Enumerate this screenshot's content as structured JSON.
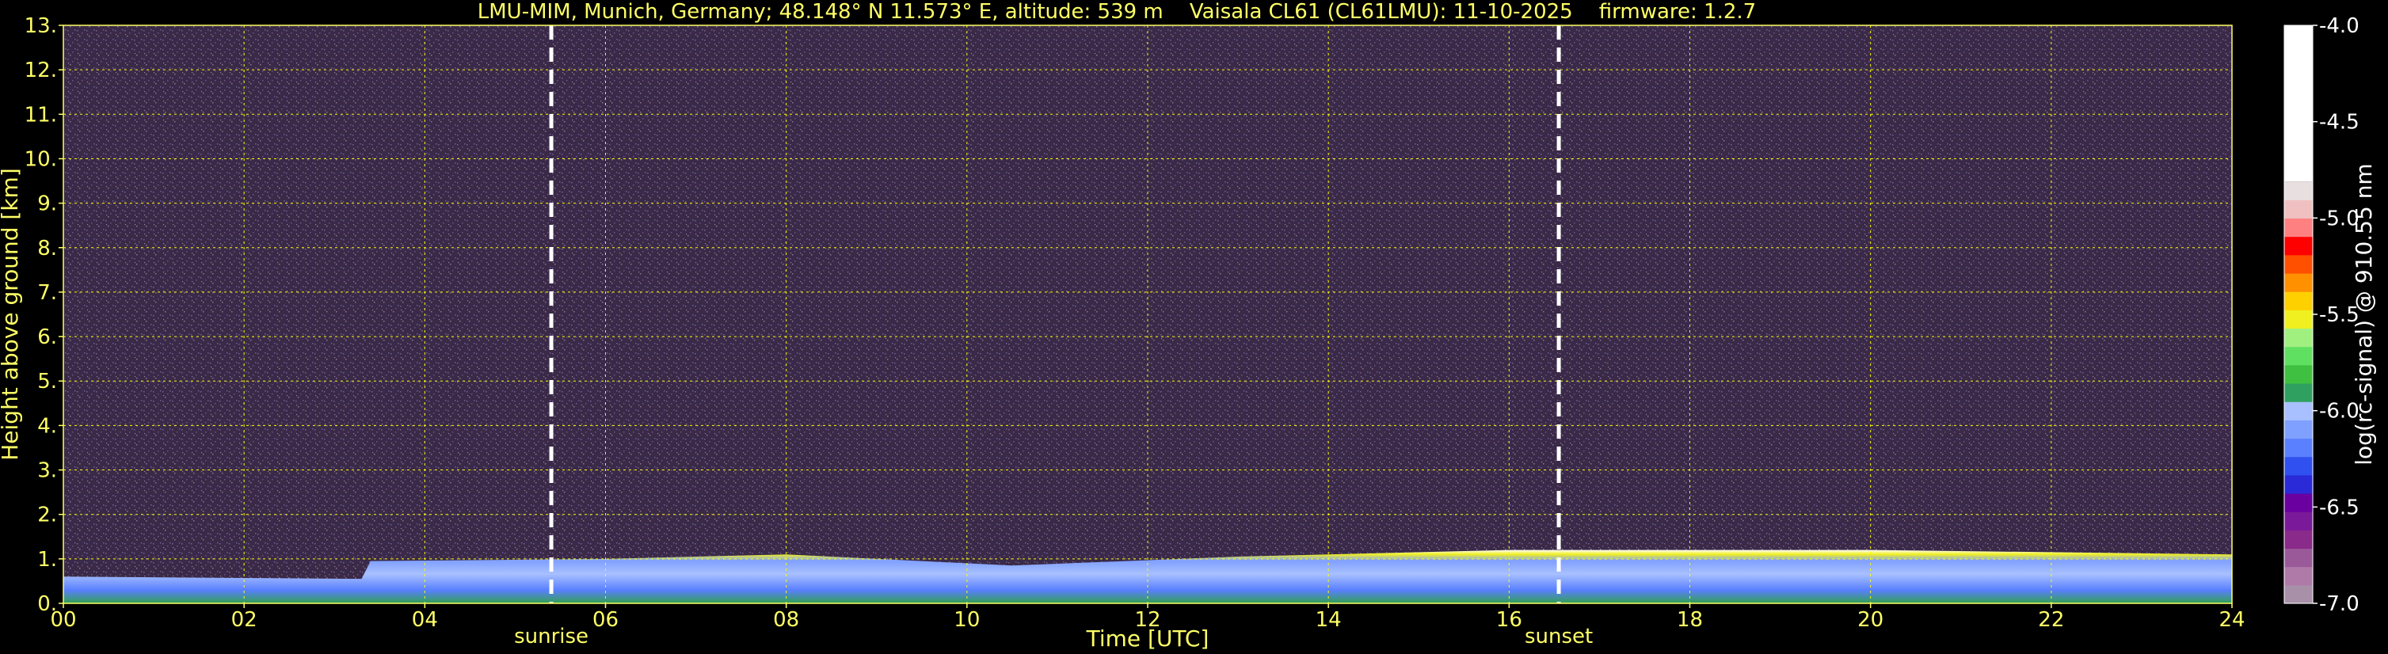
{
  "title": {
    "site": "LMU-MIM, Munich, Germany; 48.148° N 11.573° E, altitude: 539 m",
    "instrument": "Vaisala CL61 (CL61LMU): 11-10-2025",
    "firmware": "firmware: 1.2.7"
  },
  "chart_data": {
    "type": "heatmap",
    "xlabel": "Time [UTC]",
    "ylabel": "Height above ground [km]",
    "xlim": [
      0,
      24
    ],
    "ylim": [
      0,
      13
    ],
    "x_ticks": [
      "00",
      "02",
      "04",
      "06",
      "08",
      "10",
      "12",
      "14",
      "16",
      "18",
      "20",
      "22",
      "24"
    ],
    "y_ticks": [
      "0.",
      "1.",
      "2.",
      "3.",
      "4.",
      "5.",
      "6.",
      "7.",
      "8.",
      "9.",
      "10.",
      "11.",
      "12.",
      "13."
    ],
    "grid": true,
    "grid_color": "#ffff00",
    "annotations": [
      {
        "text": "sunrise",
        "x": 5.4
      },
      {
        "text": "sunset",
        "x": 16.55
      }
    ],
    "boundary_layer_top_km": [
      {
        "t": 0.0,
        "h": 0.6
      },
      {
        "t": 3.3,
        "h": 0.55
      },
      {
        "t": 3.4,
        "h": 0.95
      },
      {
        "t": 6.0,
        "h": 1.0
      },
      {
        "t": 8.0,
        "h": 1.1
      },
      {
        "t": 10.5,
        "h": 0.85
      },
      {
        "t": 13.0,
        "h": 1.05
      },
      {
        "t": 16.0,
        "h": 1.2
      },
      {
        "t": 20.0,
        "h": 1.2
      },
      {
        "t": 24.0,
        "h": 1.1
      }
    ],
    "colorbar": {
      "label": "log(rc-signal) @ 910.55 nm",
      "range": [
        -7.0,
        -4.0
      ],
      "ticks": [
        "-4.0",
        "-4.5",
        "-5.0",
        "-5.5",
        "-6.0",
        "-6.5",
        "-7.0"
      ],
      "colors": [
        "#a890a8",
        "#b07aa8",
        "#9a5a9a",
        "#8a2a8a",
        "#7a1a9a",
        "#6a00a0",
        "#2a2ad8",
        "#3050f0",
        "#5a80ff",
        "#80a0ff",
        "#a8c0ff",
        "#30a060",
        "#40c040",
        "#60e060",
        "#a0f080",
        "#f0f020",
        "#ffd000",
        "#ff9000",
        "#ff5000",
        "#ff0000",
        "#ff8080",
        "#f0c0c0",
        "#e8e0e0",
        "#ffffff"
      ]
    }
  }
}
